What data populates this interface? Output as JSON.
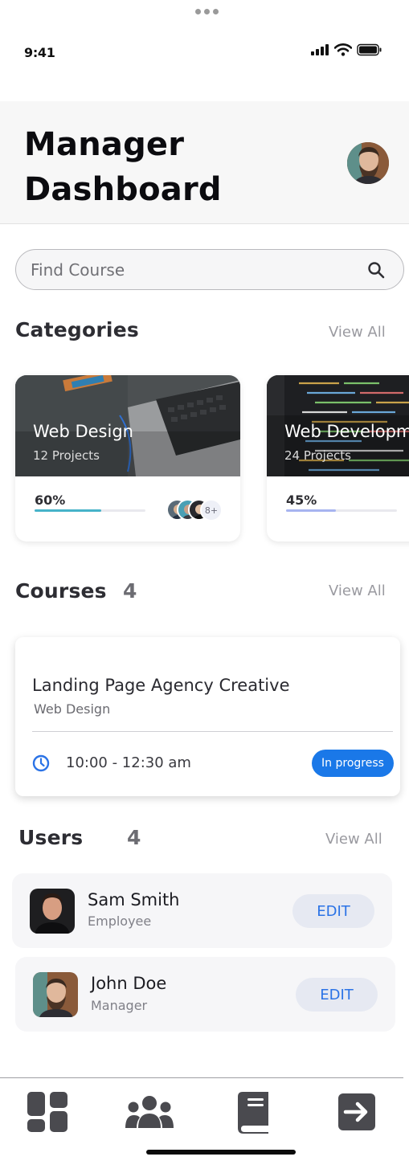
{
  "status_bar": {
    "time": "9:41"
  },
  "header": {
    "title_line1": "Manager",
    "title_line2": "Dashboard"
  },
  "search": {
    "placeholder": "Find Course"
  },
  "categories": {
    "title": "Categories",
    "view_all": "View All",
    "items": [
      {
        "name": "Web Design",
        "projects": "12 Projects",
        "progress_label": "60%",
        "progress": 0.6,
        "more_label": "8+",
        "bar_color": "#46b3c9"
      },
      {
        "name": "Web Development",
        "projects": "24 Projects",
        "progress_label": "45%",
        "progress": 0.45,
        "bar_color": "#a7b4f0"
      }
    ]
  },
  "courses": {
    "title": "Courses",
    "count": "4",
    "view_all": "View All",
    "items": [
      {
        "title": "Landing Page Agency Creative",
        "category": "Web Design",
        "time": "10:00 - 12:30 am",
        "status": "In progress"
      }
    ]
  },
  "users": {
    "title": "Users",
    "count": "4",
    "view_all": "View All",
    "items": [
      {
        "name": "Sam Smith",
        "role": "Employee",
        "edit_label": "EDIT"
      },
      {
        "name": "John Doe",
        "role": "Manager",
        "edit_label": "EDIT"
      }
    ]
  },
  "bottom_nav": {
    "items": [
      {
        "icon": "dashboard-icon"
      },
      {
        "icon": "users-group-icon"
      },
      {
        "icon": "book-icon"
      },
      {
        "icon": "logout-icon"
      }
    ]
  },
  "colors": {
    "accent": "#1a78e8",
    "edit_text": "#2b73e6",
    "nav_icon": "#4a4a4f"
  }
}
